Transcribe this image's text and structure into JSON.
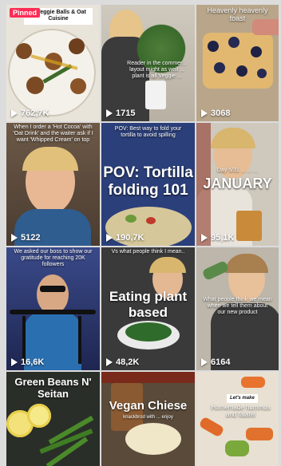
{
  "tiles": [
    {
      "views": "762,7K",
      "pinned": "Pinned",
      "caption": "... Veggie Balls & Oat Cuisine"
    },
    {
      "views": "1715",
      "caption": "Reader in the commer... layout might as well ... plant is all Veggie ..."
    },
    {
      "views": "3068",
      "caption": "Heavenly heavenly toast"
    },
    {
      "views": "5122",
      "caption": "When I order a 'Hot Cocoa' with 'Oat Drink' and the waiter ask if I want 'Whipped Cream' on top"
    },
    {
      "views": "190,7K",
      "caption_small": "POV: Best way to fold your tortilla to avoid spilling",
      "caption_big": "POV: Tortilla folding 101"
    },
    {
      "views": "95,1K",
      "caption_small": "Day 5/31 ... ... ...",
      "caption_big": "JANUARY"
    },
    {
      "views": "16,6K",
      "caption": "We asked our boss to show our gratitude for reaching 20K followers"
    },
    {
      "views": "48,2K",
      "caption_small": "Vs what people think I mean..",
      "caption_big": "Eating plant based"
    },
    {
      "views": "6164",
      "caption": "What people think we mean when we tell them about our new product"
    },
    {
      "caption_big": "Green Beans N' Seitan"
    },
    {
      "caption_big": "Vegan Chiese",
      "caption_small": "knackbrod with ... enjoy"
    },
    {
      "badge": "Let's make",
      "caption": "Homemade hummus and falafel"
    }
  ]
}
